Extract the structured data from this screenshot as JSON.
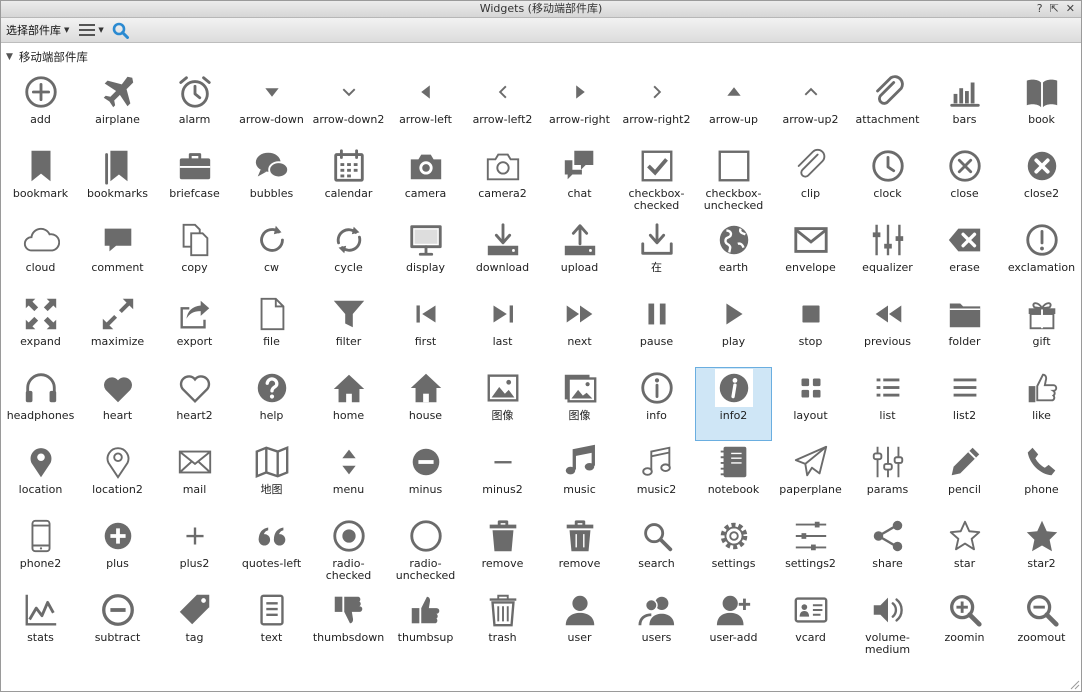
{
  "window": {
    "title": "Widgets (移动端部件库)",
    "controls": [
      "?",
      "⇱",
      "✕"
    ]
  },
  "toolbar": {
    "select_label": "选择部件库"
  },
  "section": {
    "label": "移动端部件库"
  },
  "accent_color": "#2b8ad1",
  "icon_color": "#6b6b6b",
  "selected_index": 65,
  "widgets": [
    {
      "label": "add",
      "icon": "add"
    },
    {
      "label": "airplane",
      "icon": "airplane"
    },
    {
      "label": "alarm",
      "icon": "alarm"
    },
    {
      "label": "arrow-down",
      "icon": "arrow-down"
    },
    {
      "label": "arrow-down2",
      "icon": "arrow-down2"
    },
    {
      "label": "arrow-left",
      "icon": "arrow-left"
    },
    {
      "label": "arrow-left2",
      "icon": "arrow-left2"
    },
    {
      "label": "arrow-right",
      "icon": "arrow-right"
    },
    {
      "label": "arrow-right2",
      "icon": "arrow-right2"
    },
    {
      "label": "arrow-up",
      "icon": "arrow-up"
    },
    {
      "label": "arrow-up2",
      "icon": "arrow-up2"
    },
    {
      "label": "attachment",
      "icon": "attachment"
    },
    {
      "label": "bars",
      "icon": "bars"
    },
    {
      "label": "book",
      "icon": "book"
    },
    {
      "label": "bookmark",
      "icon": "bookmark"
    },
    {
      "label": "bookmarks",
      "icon": "bookmarks"
    },
    {
      "label": "briefcase",
      "icon": "briefcase"
    },
    {
      "label": "bubbles",
      "icon": "bubbles"
    },
    {
      "label": "calendar",
      "icon": "calendar"
    },
    {
      "label": "camera",
      "icon": "camera"
    },
    {
      "label": "camera2",
      "icon": "camera2"
    },
    {
      "label": "chat",
      "icon": "chat"
    },
    {
      "label": "checkbox-\nchecked",
      "icon": "checkbox-checked"
    },
    {
      "label": "checkbox-\nunchecked",
      "icon": "checkbox-unchecked"
    },
    {
      "label": "clip",
      "icon": "clip"
    },
    {
      "label": "clock",
      "icon": "clock"
    },
    {
      "label": "close",
      "icon": "close"
    },
    {
      "label": "close2",
      "icon": "close2"
    },
    {
      "label": "cloud",
      "icon": "cloud"
    },
    {
      "label": "comment",
      "icon": "comment"
    },
    {
      "label": "copy",
      "icon": "copy"
    },
    {
      "label": "cw",
      "icon": "cw"
    },
    {
      "label": "cycle",
      "icon": "cycle"
    },
    {
      "label": "display",
      "icon": "display"
    },
    {
      "label": "download",
      "icon": "download"
    },
    {
      "label": "upload",
      "icon": "upload"
    },
    {
      "label": "在",
      "icon": "download-box"
    },
    {
      "label": "earth",
      "icon": "earth"
    },
    {
      "label": "envelope",
      "icon": "envelope"
    },
    {
      "label": "equalizer",
      "icon": "equalizer"
    },
    {
      "label": "erase",
      "icon": "erase"
    },
    {
      "label": "exclamation",
      "icon": "exclamation"
    },
    {
      "label": "expand",
      "icon": "expand"
    },
    {
      "label": "maximize",
      "icon": "maximize"
    },
    {
      "label": "export",
      "icon": "export"
    },
    {
      "label": "file",
      "icon": "file"
    },
    {
      "label": "filter",
      "icon": "filter"
    },
    {
      "label": "first",
      "icon": "first"
    },
    {
      "label": "last",
      "icon": "last"
    },
    {
      "label": "next",
      "icon": "next"
    },
    {
      "label": "pause",
      "icon": "pause"
    },
    {
      "label": "play",
      "icon": "play"
    },
    {
      "label": "stop",
      "icon": "stop"
    },
    {
      "label": "previous",
      "icon": "previous"
    },
    {
      "label": "folder",
      "icon": "folder"
    },
    {
      "label": "gift",
      "icon": "gift"
    },
    {
      "label": "headphones",
      "icon": "headphones"
    },
    {
      "label": "heart",
      "icon": "heart"
    },
    {
      "label": "heart2",
      "icon": "heart2"
    },
    {
      "label": "help",
      "icon": "help"
    },
    {
      "label": "home",
      "icon": "home"
    },
    {
      "label": "house",
      "icon": "house"
    },
    {
      "label": "图像",
      "icon": "image"
    },
    {
      "label": "图像",
      "icon": "images"
    },
    {
      "label": "info",
      "icon": "info"
    },
    {
      "label": "info2",
      "icon": "info2"
    },
    {
      "label": "layout",
      "icon": "layout"
    },
    {
      "label": "list",
      "icon": "list"
    },
    {
      "label": "list2",
      "icon": "list2"
    },
    {
      "label": "like",
      "icon": "like"
    },
    {
      "label": "location",
      "icon": "location"
    },
    {
      "label": "location2",
      "icon": "location2"
    },
    {
      "label": "mail",
      "icon": "mail"
    },
    {
      "label": "地图",
      "icon": "map"
    },
    {
      "label": "menu",
      "icon": "menu"
    },
    {
      "label": "minus",
      "icon": "minus"
    },
    {
      "label": "minus2",
      "icon": "minus2"
    },
    {
      "label": "music",
      "icon": "music"
    },
    {
      "label": "music2",
      "icon": "music2"
    },
    {
      "label": "notebook",
      "icon": "notebook"
    },
    {
      "label": "paperplane",
      "icon": "paperplane"
    },
    {
      "label": "params",
      "icon": "params"
    },
    {
      "label": "pencil",
      "icon": "pencil"
    },
    {
      "label": "phone",
      "icon": "phone"
    },
    {
      "label": "phone2",
      "icon": "phone2"
    },
    {
      "label": "plus",
      "icon": "plus"
    },
    {
      "label": "plus2",
      "icon": "plus2"
    },
    {
      "label": "quotes-left",
      "icon": "quotes-left"
    },
    {
      "label": "radio-\nchecked",
      "icon": "radio-checked"
    },
    {
      "label": "radio-\nunchecked",
      "icon": "radio-unchecked"
    },
    {
      "label": "remove",
      "icon": "remove"
    },
    {
      "label": "remove",
      "icon": "remove2"
    },
    {
      "label": "search",
      "icon": "search"
    },
    {
      "label": "settings",
      "icon": "settings"
    },
    {
      "label": "settings2",
      "icon": "settings2"
    },
    {
      "label": "share",
      "icon": "share"
    },
    {
      "label": "star",
      "icon": "star"
    },
    {
      "label": "star2",
      "icon": "star2"
    },
    {
      "label": "stats",
      "icon": "stats"
    },
    {
      "label": "subtract",
      "icon": "subtract"
    },
    {
      "label": "tag",
      "icon": "tag"
    },
    {
      "label": "text",
      "icon": "text"
    },
    {
      "label": "thumbsdown",
      "icon": "thumbsdown"
    },
    {
      "label": "thumbsup",
      "icon": "thumbsup"
    },
    {
      "label": "trash",
      "icon": "trash"
    },
    {
      "label": "user",
      "icon": "user"
    },
    {
      "label": "users",
      "icon": "users"
    },
    {
      "label": "user-add",
      "icon": "user-add"
    },
    {
      "label": "vcard",
      "icon": "vcard"
    },
    {
      "label": "volume-\nmedium",
      "icon": "volume-medium"
    },
    {
      "label": "zoomin",
      "icon": "zoomin"
    },
    {
      "label": "zoomout",
      "icon": "zoomout"
    }
  ]
}
